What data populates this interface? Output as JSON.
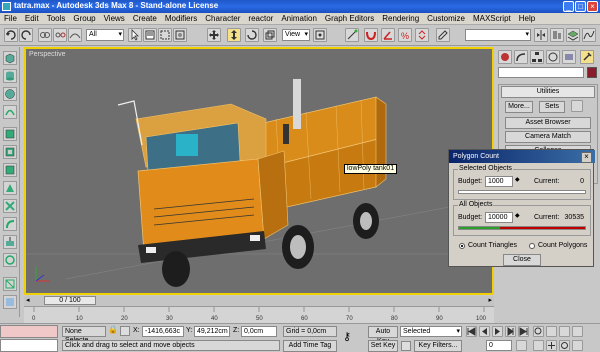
{
  "window": {
    "title": "tatra.max - Autodesk 3ds Max 8  - Stand-alone License",
    "minimize": "_",
    "maximize": "□",
    "close": "×"
  },
  "menu": [
    "File",
    "Edit",
    "Tools",
    "Group",
    "Views",
    "Create",
    "Modifiers",
    "Character",
    "reactor",
    "Animation",
    "Graph Editors",
    "Rendering",
    "Customize",
    "MAXScript",
    "Help"
  ],
  "toolbar": {
    "selection_filter": "All",
    "ref_coord": "View"
  },
  "viewport": {
    "label": "Perspective",
    "tooltip": "lowPoly tank01"
  },
  "command_panel": {
    "rollout_title": "Utilities",
    "more_button": "More...",
    "sets_button": "Sets",
    "buttons": [
      "Asset Browser",
      "Camera Match",
      "Collapse"
    ]
  },
  "polygon_count": {
    "title": "Polygon Count",
    "close": "×",
    "selected_group": "Selected Objects",
    "selected_budget_label": "Budget:",
    "selected_budget": "1000",
    "selected_current_label": "Current:",
    "selected_current": "0",
    "all_group": "All Objects",
    "all_budget_label": "Budget:",
    "all_budget": "10000",
    "all_current_label": "Current:",
    "all_current": "30535",
    "count_triangles": "Count Triangles",
    "count_polygons": "Count Polygons",
    "close_button": "Close",
    "colors": {
      "over_budget": "#c00000",
      "under_budget": "#2aa02a"
    }
  },
  "timeline": {
    "frame_readout": "0 / 100",
    "ticks": [
      "0",
      "10",
      "20",
      "30",
      "40",
      "50",
      "60",
      "70",
      "80",
      "90",
      "100"
    ]
  },
  "status": {
    "selection": "None Selecte",
    "x_label": "X:",
    "x_value": "-1416,663c",
    "y_label": "Y:",
    "y_value": "49,212cm",
    "z_label": "Z:",
    "z_value": "0,0cm",
    "grid": "Grid = 0,0cm",
    "prompt": "Click and drag to select and move objects",
    "add_time_tag": "Add Time Tag",
    "auto_key": "Auto Key",
    "set_key": "Set Key",
    "key_mode": "Selected",
    "key_filters": "Key Filters...",
    "frame": "0"
  }
}
